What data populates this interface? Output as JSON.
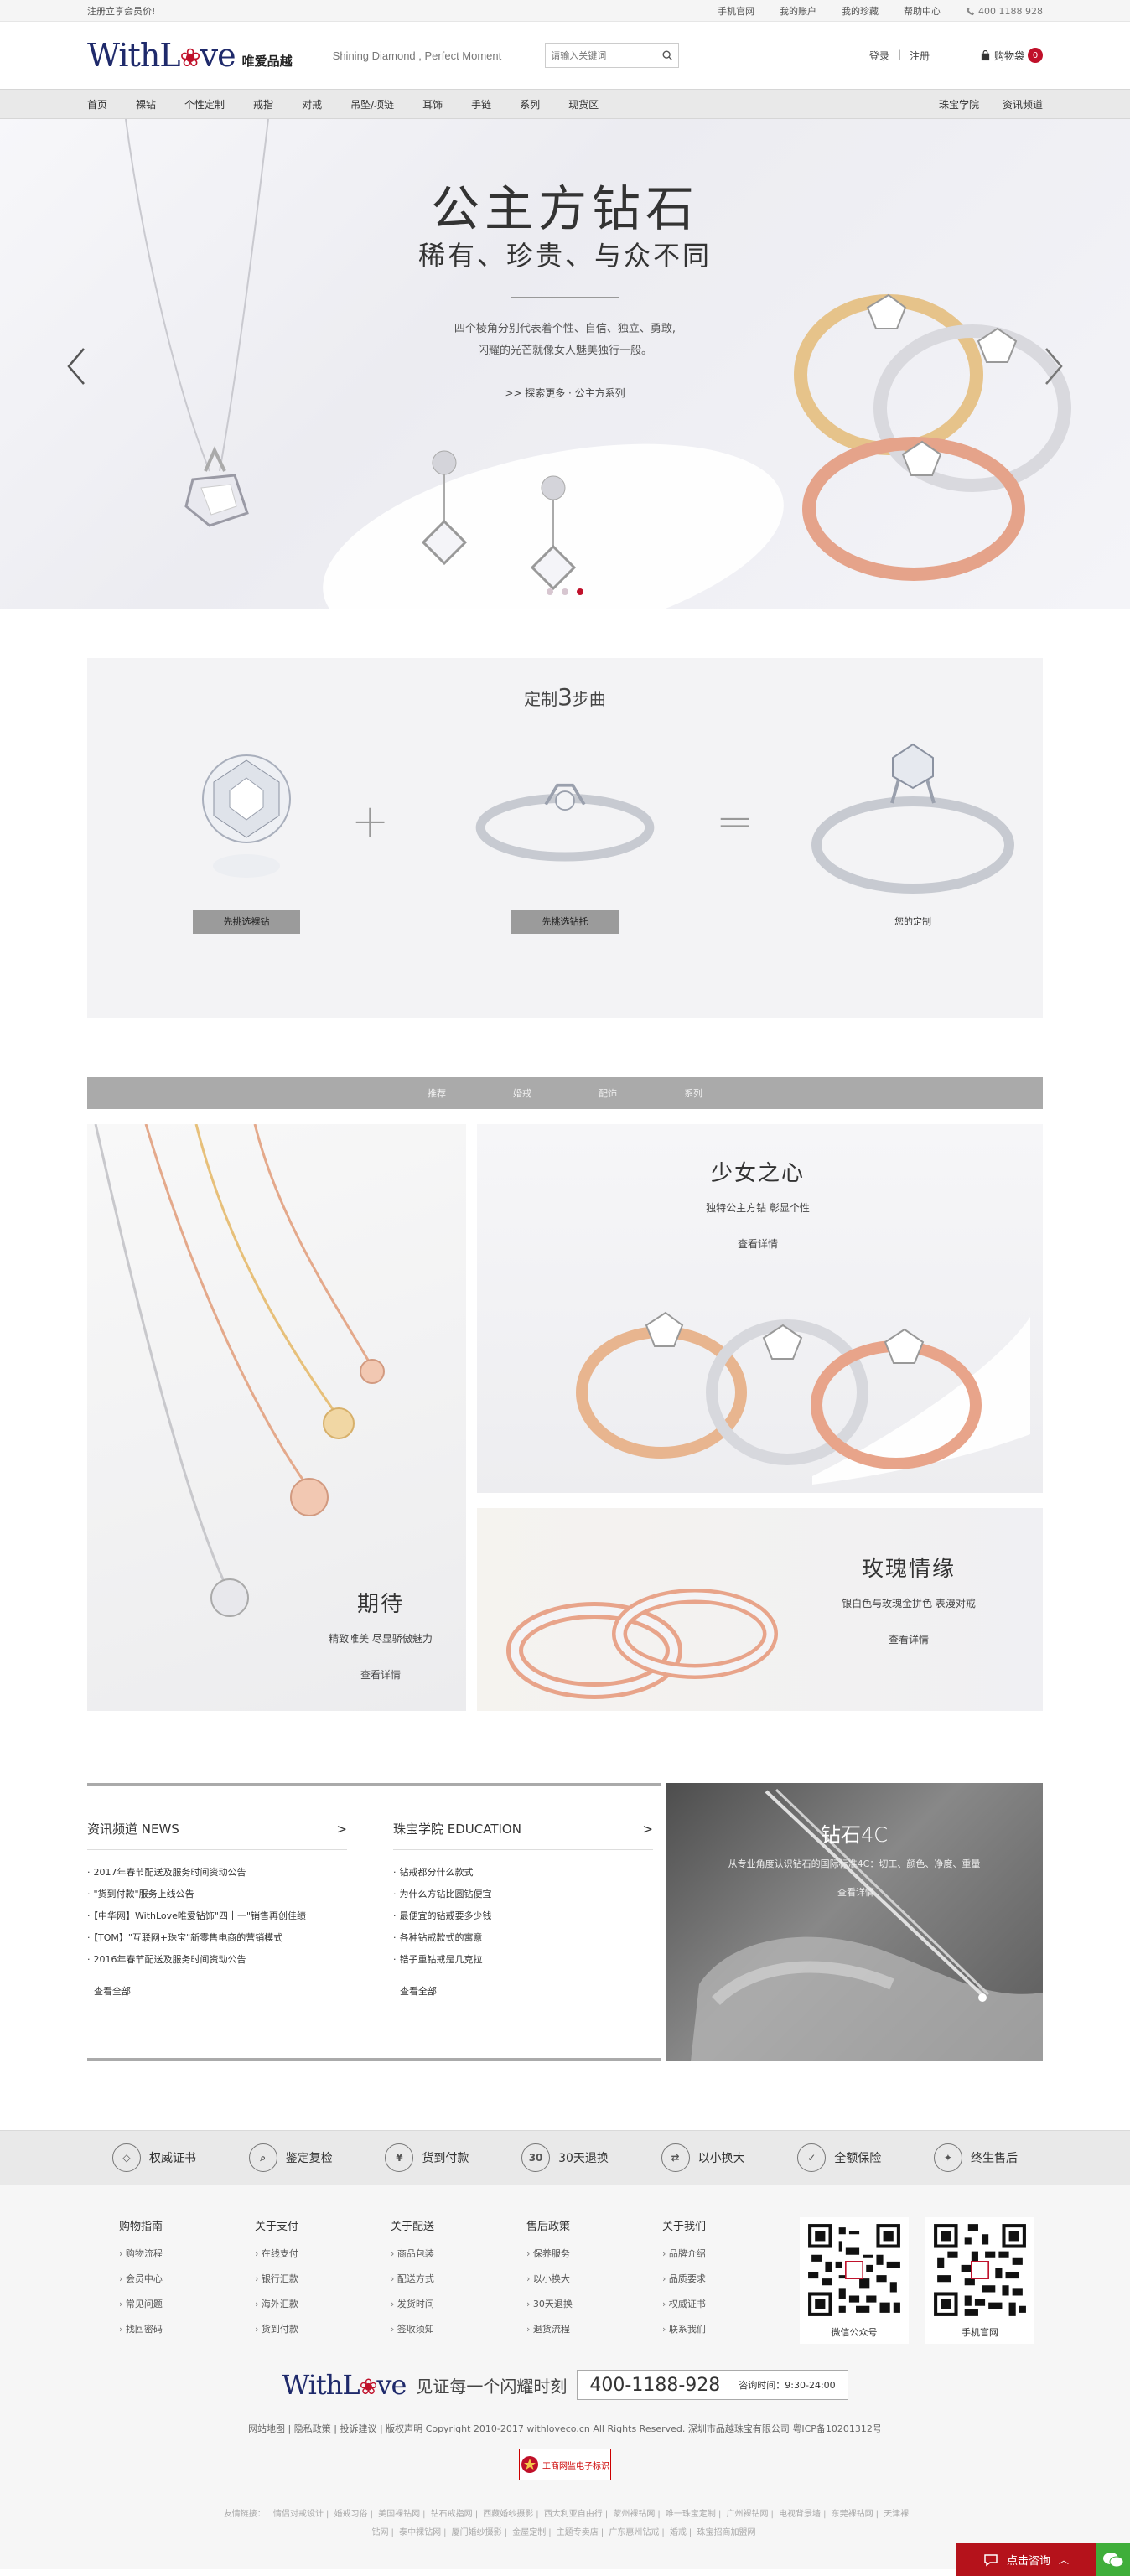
{
  "topbar": {
    "register_promo": "注册立享会员价!",
    "links": [
      "手机官网",
      "我的账户",
      "我的珍藏",
      "帮助中心"
    ],
    "phone": "400 1188 928"
  },
  "header": {
    "logo_en_a": "With",
    "logo_en_b": "L",
    "logo_en_c": "ve",
    "logo_cn": "唯爱品越",
    "slogan": "Shining Diamond , Perfect Moment",
    "search_placeholder": "请输入关键词",
    "login": "登录",
    "sep": "|",
    "register": "注册",
    "cart_label": "购物袋",
    "cart_count": "0"
  },
  "nav": {
    "items": [
      "首页",
      "裸钻",
      "个性定制",
      "戒指",
      "对戒",
      "吊坠/项链",
      "耳饰",
      "手链",
      "系列",
      "现货区"
    ],
    "right": [
      "珠宝学院",
      "资讯频道"
    ]
  },
  "banner": {
    "title": "公主方钻石",
    "subtitle": "稀有、珍贵、与众不同",
    "desc_1": "四个棱角分别代表着个性、自信、独立、勇敢,",
    "desc_2": "闪耀的光芒就像女人魅美独行一般。",
    "more": ">> 探索更多 · 公主方系列",
    "slide_count": 3,
    "active_slide": 3
  },
  "steps": {
    "title_a": "定制",
    "title_num": "3",
    "title_b": "步曲",
    "step1_btn": "先挑选裸钻",
    "step2_btn": "先挑选钻托",
    "step3_label": "您的定制",
    "plus": "+",
    "equals": "="
  },
  "product_tabs": [
    "推荐",
    "婚戒",
    "配饰",
    "系列"
  ],
  "products": {
    "necklace": {
      "title": "期待",
      "desc": "精致唯美  尽显骄傲魅力",
      "more": "查看详情"
    },
    "princess": {
      "title": "少女之心",
      "desc": "独特公主方钻  彰显个性",
      "more": "查看详情"
    },
    "rose": {
      "title": "玫瑰情缘",
      "desc": "银白色与玫瑰金拼色  表漫对戒",
      "more": "查看详情"
    }
  },
  "news": {
    "title": "资讯频道 NEWS",
    "arrow": ">",
    "items": [
      "2017年春节配送及服务时间资动公告",
      "\"货到付款\"服务上线公告",
      "【中华网】WithLove唯爱钻饰\"四十一\"销售再创佳绩",
      "【TOM】\"互联网+珠宝\"新零售电商的营销模式",
      "2016年春节配送及服务时间资动公告"
    ],
    "all": "查看全部"
  },
  "education": {
    "title": "珠宝学院 EDUCATION",
    "arrow": ">",
    "items": [
      "钻戒都分什么款式",
      "为什么方钻比圆钻便宜",
      "最便宜的钻戒要多少钱",
      "各种钻戒款式的寓意",
      "锆子重钻戒是几克拉"
    ],
    "all": "查看全部"
  },
  "diamond4c": {
    "title": "钻石4C",
    "desc": "从专业角度认识钻石的国际标准4C：切工、颜色、净度、重量",
    "more": "查看详情"
  },
  "services": [
    "权威证书",
    "鉴定复检",
    "货到付款",
    "30天退换",
    "以小换大",
    "全额保险",
    "终生售后"
  ],
  "service_icons": [
    "certificate-icon",
    "magnifier-icon",
    "cod-icon",
    "30-days-icon",
    "exchange-icon",
    "shield-icon",
    "lifetime-icon"
  ],
  "footer": {
    "cols": [
      {
        "title": "购物指南",
        "links": [
          "购物流程",
          "会员中心",
          "常见问题",
          "找回密码"
        ]
      },
      {
        "title": "关于支付",
        "links": [
          "在线支付",
          "银行汇款",
          "海外汇款",
          "货到付款"
        ]
      },
      {
        "title": "关于配送",
        "links": [
          "商品包装",
          "配送方式",
          "发货时间",
          "签收须知"
        ]
      },
      {
        "title": "售后政策",
        "links": [
          "保养服务",
          "以小换大",
          "30天退换",
          "退货流程"
        ]
      },
      {
        "title": "关于我们",
        "links": [
          "品牌介绍",
          "品质要求",
          "权威证书",
          "联系我们"
        ]
      }
    ],
    "qr_wechat": "微信公众号",
    "qr_mobile": "手机官网",
    "slogan": "见证每一个闪耀时刻",
    "tel": "400-1188-928",
    "hours": "咨询时间：9:30-24:00",
    "copyright": "网站地图  |  隐私政策  |  投诉建议  |  版权声明 Copyright 2010-2017 withloveco.cn All Rights Reserved. 深圳市品越珠宝有限公司    粤ICP备10201312号",
    "icp_badge": "工商网监电子标识",
    "friend_label": "友情链接：",
    "friend_links": [
      "情侣对戒设计",
      "婚戒习俗",
      "美国裸钻网",
      "钻石戒指网",
      "西藏婚纱摄影",
      "西大利亚自由行",
      "蒙州裸钻网",
      "唯一珠宝定制",
      "广州裸钻网",
      "电视背景墙",
      "东莞裸钻网",
      "天津裸钻网",
      "泰中裸钻网",
      "厦门婚纱摄影",
      "金屋定制",
      "主题专卖店",
      "广东惠州钻戒",
      "婚戒",
      "珠宝招商加盟网"
    ]
  },
  "consult": {
    "label": "点击咨询"
  },
  "colors": {
    "brand_navy": "#1f2a6b",
    "brand_red": "#c0102a",
    "consult_red": "#b5121b",
    "wechat_green": "#3fae3a"
  }
}
